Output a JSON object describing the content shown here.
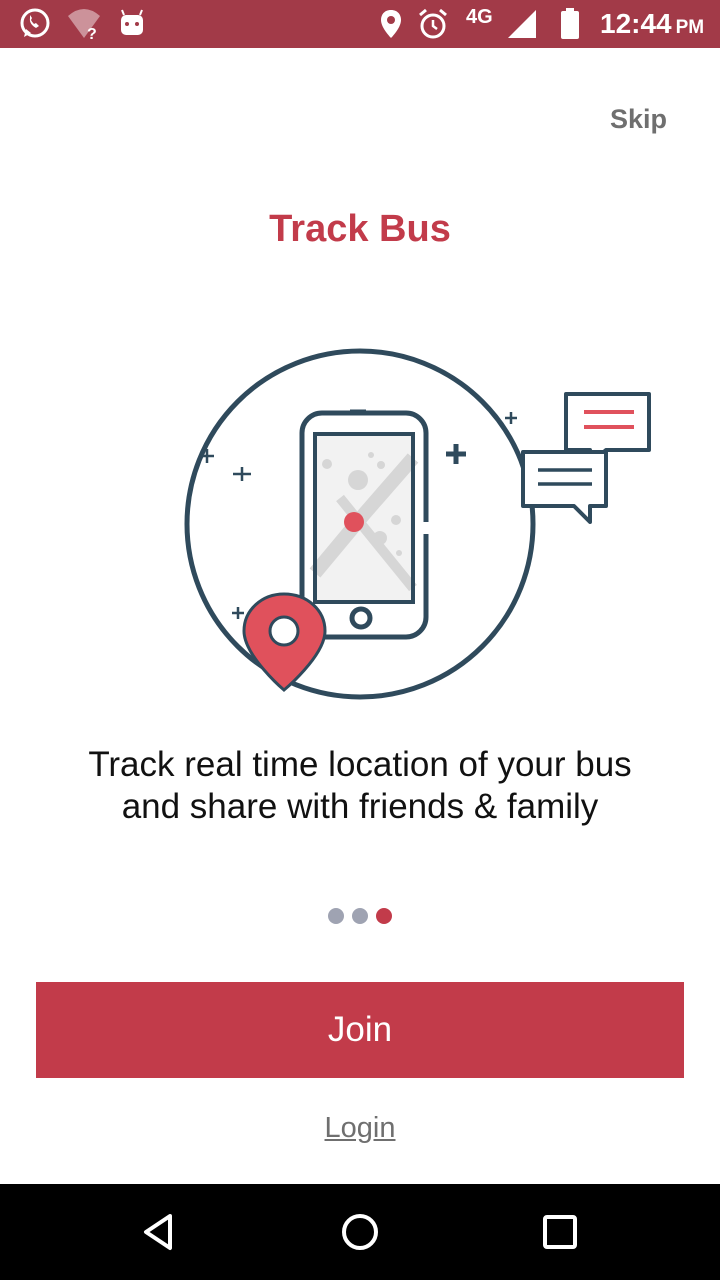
{
  "status_bar": {
    "network_label": "4G",
    "time": "12:44",
    "ampm": "PM",
    "icons": [
      "whatsapp-icon",
      "wifi-unknown-icon",
      "android-icon",
      "location-icon",
      "alarm-icon",
      "signal-icon",
      "battery-icon"
    ],
    "background_color": "#a23a48"
  },
  "onboarding": {
    "skip_label": "Skip",
    "title": "Track Bus",
    "description_line1": "Track real time location of your bus",
    "description_line2": "and share with friends & family",
    "illustration": "phone-map-location-chat-illustration",
    "pagination": {
      "total": 3,
      "active_index": 2
    }
  },
  "actions": {
    "join_label": "Join",
    "login_label": "Login"
  },
  "nav_bar": {
    "icons": [
      "back-icon",
      "home-icon",
      "recents-icon"
    ]
  },
  "colors": {
    "accent": "#c23b4a",
    "dot_inactive": "#9fa3b2",
    "illustration_stroke": "#2f4a5c",
    "skip_text": "#6f6f6f"
  }
}
